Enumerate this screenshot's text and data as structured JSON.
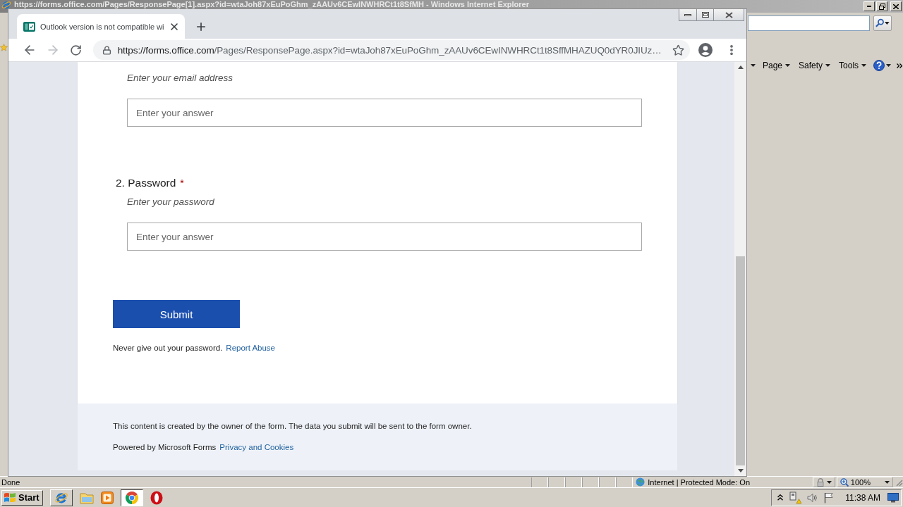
{
  "ie_window": {
    "title": "https://forms.office.com/Pages/ResponsePage[1].aspx?id=wtaJoh87xEuPoGhm_zAAUv6CEwINWHRCt1t8SfMH - Windows Internet Explorer",
    "command_bar": [
      {
        "label": "Page"
      },
      {
        "label": "Safety"
      },
      {
        "label": "Tools"
      }
    ],
    "status_bar": {
      "text": "Done",
      "zone": "Internet | Protected Mode: On",
      "zoom": "100%"
    }
  },
  "browser": {
    "tabs": [
      {
        "title": "Outlook version is not compatible wi",
        "selected": true
      }
    ],
    "nav": {
      "back_disabled": false,
      "forward_disabled": true
    },
    "address": {
      "host": "https://forms.office.com",
      "path": "/Pages/ResponsePage.aspx?id=wtaJoh87xEuPoGhm_zAAUv6CEwINWHRCt1t8SffMHAZUQ0dYR0JIUz…"
    }
  },
  "form": {
    "questions": [
      {
        "hint": "Enter your email address",
        "placeholder": "Enter your answer"
      },
      {
        "title": "2. Password",
        "required_mark": "*",
        "hint": "Enter your password",
        "placeholder": "Enter your answer"
      }
    ],
    "submit": "Submit",
    "notice": "Never give out your password.",
    "report_link": "Report Abuse"
  },
  "footer": {
    "notice": "This content is created by the owner of the form. The data you submit will be sent to the form owner.",
    "powered_by": "Powered by Microsoft Forms",
    "privacy_link": "Privacy and Cookies"
  },
  "taskbar": {
    "start": "Start",
    "apps": [
      {
        "kind": "ie",
        "open": true,
        "selected": false
      },
      {
        "kind": "folder",
        "open": false,
        "selected": false
      },
      {
        "kind": "media",
        "open": false,
        "selected": false
      },
      {
        "kind": "chrome",
        "open": true,
        "selected": true
      },
      {
        "kind": "ring",
        "open": false,
        "selected": false
      }
    ],
    "clock": "11:38 AM"
  }
}
